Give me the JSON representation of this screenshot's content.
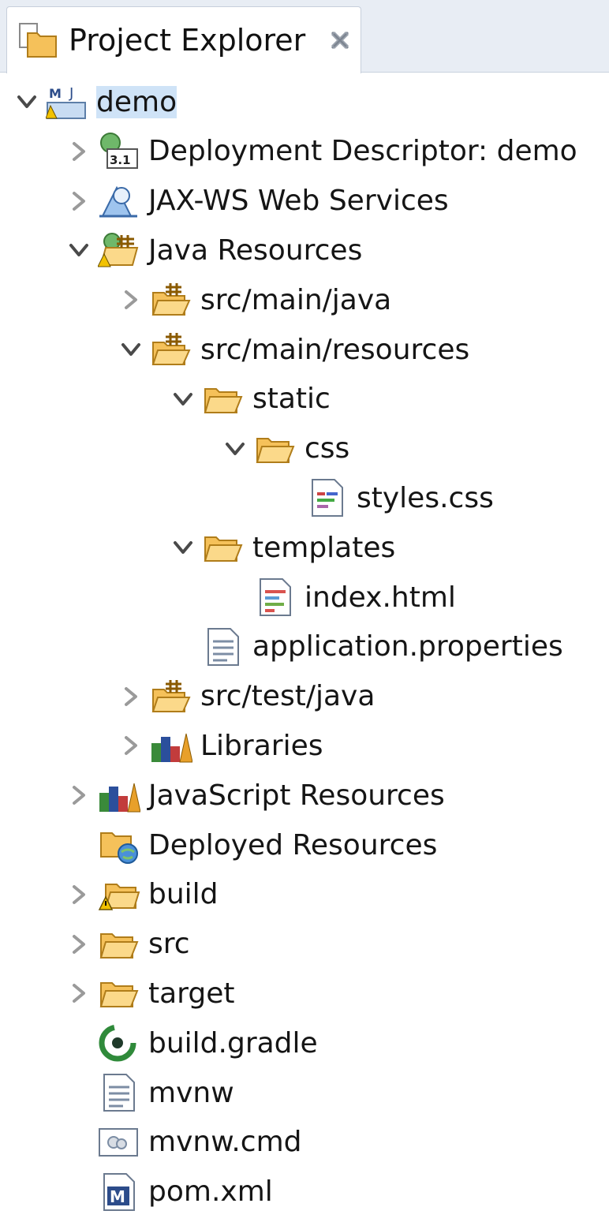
{
  "view": {
    "title": "Project Explorer",
    "close_icon": "close-x-icon"
  },
  "tree": [
    {
      "label": "demo",
      "depth": 0,
      "state": "expanded",
      "icon": "maven-web-project-icon",
      "selected": true
    },
    {
      "label": "Deployment Descriptor: demo",
      "depth": 1,
      "state": "collapsed",
      "icon": "deployment-descriptor-icon"
    },
    {
      "label": "JAX-WS Web Services",
      "depth": 1,
      "state": "collapsed",
      "icon": "web-services-icon"
    },
    {
      "label": "Java Resources",
      "depth": 1,
      "state": "expanded",
      "icon": "java-resources-icon"
    },
    {
      "label": "src/main/java",
      "depth": 2,
      "state": "collapsed",
      "icon": "source-folder-icon"
    },
    {
      "label": "src/main/resources",
      "depth": 2,
      "state": "expanded",
      "icon": "source-folder-icon"
    },
    {
      "label": "static",
      "depth": 3,
      "state": "expanded",
      "icon": "folder-icon"
    },
    {
      "label": "css",
      "depth": 4,
      "state": "expanded",
      "icon": "folder-icon"
    },
    {
      "label": "styles.css",
      "depth": 5,
      "state": "none",
      "icon": "css-file-icon"
    },
    {
      "label": "templates",
      "depth": 3,
      "state": "expanded",
      "icon": "folder-icon"
    },
    {
      "label": "index.html",
      "depth": 4,
      "state": "none",
      "icon": "html-file-icon"
    },
    {
      "label": "application.properties",
      "depth": 3,
      "state": "none",
      "icon": "text-file-icon"
    },
    {
      "label": "src/test/java",
      "depth": 2,
      "state": "collapsed",
      "icon": "source-folder-icon"
    },
    {
      "label": "Libraries",
      "depth": 2,
      "state": "collapsed",
      "icon": "libraries-icon"
    },
    {
      "label": "JavaScript Resources",
      "depth": 1,
      "state": "collapsed",
      "icon": "libraries-icon"
    },
    {
      "label": "Deployed Resources",
      "depth": 1,
      "state": "none",
      "icon": "deployed-resources-icon"
    },
    {
      "label": "build",
      "depth": 1,
      "state": "collapsed",
      "icon": "warning-folder-icon"
    },
    {
      "label": "src",
      "depth": 1,
      "state": "collapsed",
      "icon": "folder-icon"
    },
    {
      "label": "target",
      "depth": 1,
      "state": "collapsed",
      "icon": "folder-icon"
    },
    {
      "label": "build.gradle",
      "depth": 1,
      "state": "none",
      "icon": "gradle-file-icon"
    },
    {
      "label": "mvnw",
      "depth": 1,
      "state": "none",
      "icon": "text-file-icon"
    },
    {
      "label": "mvnw.cmd",
      "depth": 1,
      "state": "none",
      "icon": "cmd-file-icon"
    },
    {
      "label": "pom.xml",
      "depth": 1,
      "state": "none",
      "icon": "maven-pom-icon"
    }
  ],
  "colors": {
    "folder": "#f5c15a",
    "folder_stroke": "#b07d1a",
    "selection": "#cfe3f7",
    "chevron": "#4a4a4a"
  }
}
